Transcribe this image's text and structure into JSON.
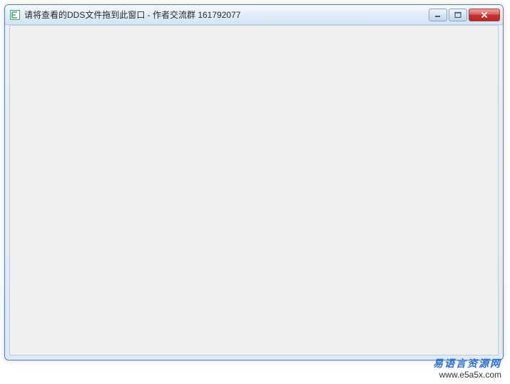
{
  "window": {
    "title": "请将查看的DDS文件拖到此窗口 - 作者交流群 161792077"
  },
  "watermark": {
    "text_cn": "易语言资源网",
    "url": "www.e5a5x.com"
  }
}
